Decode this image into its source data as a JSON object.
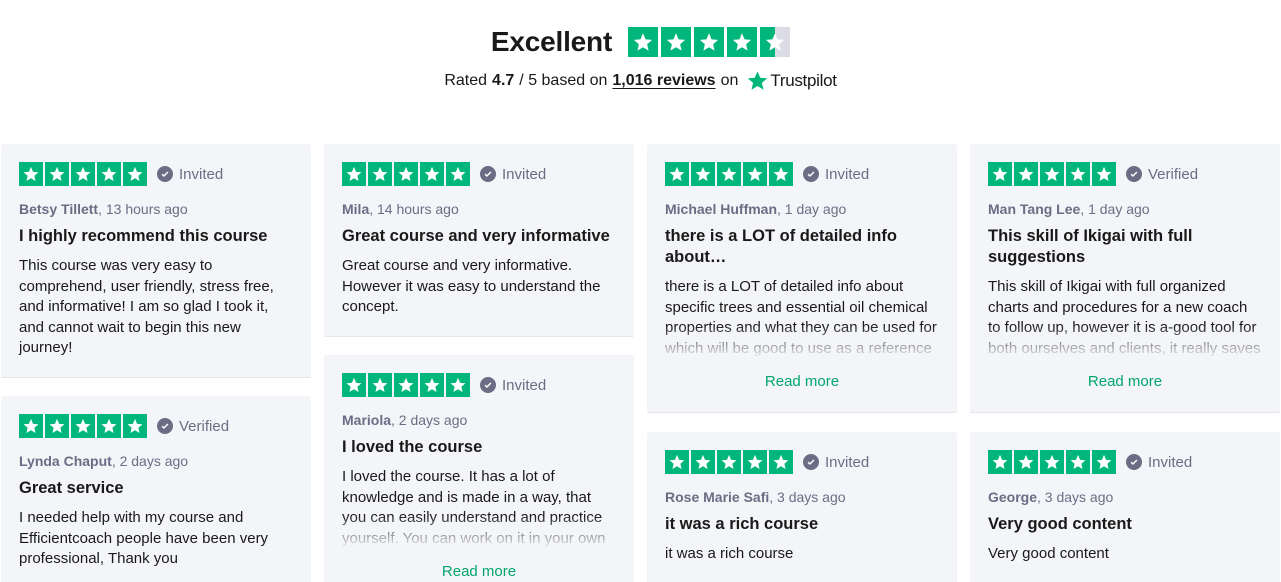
{
  "header": {
    "rating_word": "Excellent",
    "stars_value": 4.5,
    "rated_prefix": "Rated",
    "score": "4.7",
    "score_suffix": "/ 5 based on",
    "reviews_count": "1,016 reviews",
    "on": "on",
    "brand": "Trustpilot"
  },
  "colors": {
    "star_green": "#00b67a",
    "star_empty": "#dcdce6",
    "read_more": "#00a66b",
    "card_bg": "#f4f5f8",
    "muted": "#6c6c85"
  },
  "icons": {
    "star": "star-icon",
    "check": "check-circle-icon",
    "brand": "trustpilot-star-icon"
  },
  "reviews": [
    {
      "stars": 5,
      "badge": "Invited",
      "author": "Betsy Tillett",
      "time": "13 hours ago",
      "title": "I highly recommend this course",
      "body": "This course was very easy to comprehend, user friendly, stress free, and informative! I am so glad I took it, and cannot wait to begin this new journey!",
      "read_more": ""
    },
    {
      "stars": 5,
      "badge": "Verified",
      "author": "Lynda Chaput",
      "time": "2 days ago",
      "title": "Great service",
      "body": "I needed help with my course and Efficientcoach people have been very professional, Thank you",
      "read_more": ""
    },
    {
      "stars": 5,
      "badge": "Invited",
      "author": "Mila",
      "time": "14 hours ago",
      "title": "Great course and very informative",
      "body": "Great course and very informative. However it was easy to understand the concept.",
      "read_more": ""
    },
    {
      "stars": 5,
      "badge": "Invited",
      "author": "Mariola",
      "time": "2 days ago",
      "title": "I loved the course",
      "body": "I loved the course. It has a lot of knowledge and is made in a way, that you can easily understand and practice yourself. You can work on it in your own",
      "read_more": "Read more"
    },
    {
      "stars": 5,
      "badge": "Invited",
      "author": "Michael Huffman",
      "time": "1 day ago",
      "title": "there is a LOT of detailed info about…",
      "body": "there is a LOT of detailed info about specific trees and essential oil chemical properties and what they can be used for which will be good to use as a reference",
      "read_more": "Read more"
    },
    {
      "stars": 5,
      "badge": "Invited",
      "author": "Rose Marie Safi",
      "time": "3 days ago",
      "title": "it was a rich course",
      "body": "it was a rich course",
      "read_more": ""
    },
    {
      "stars": 5,
      "badge": "Verified",
      "author": "Man Tang Lee",
      "time": "1 day ago",
      "title": "This skill of Ikigai with full suggestions",
      "body": "This skill of Ikigai with full organized charts and procedures for a new coach to follow up, however it is a-good tool for both ourselves and clients, it really saves",
      "read_more": "Read more"
    },
    {
      "stars": 5,
      "badge": "Invited",
      "author": "George",
      "time": "3 days ago",
      "title": "Very good content",
      "body": "Very good content",
      "read_more": ""
    }
  ]
}
